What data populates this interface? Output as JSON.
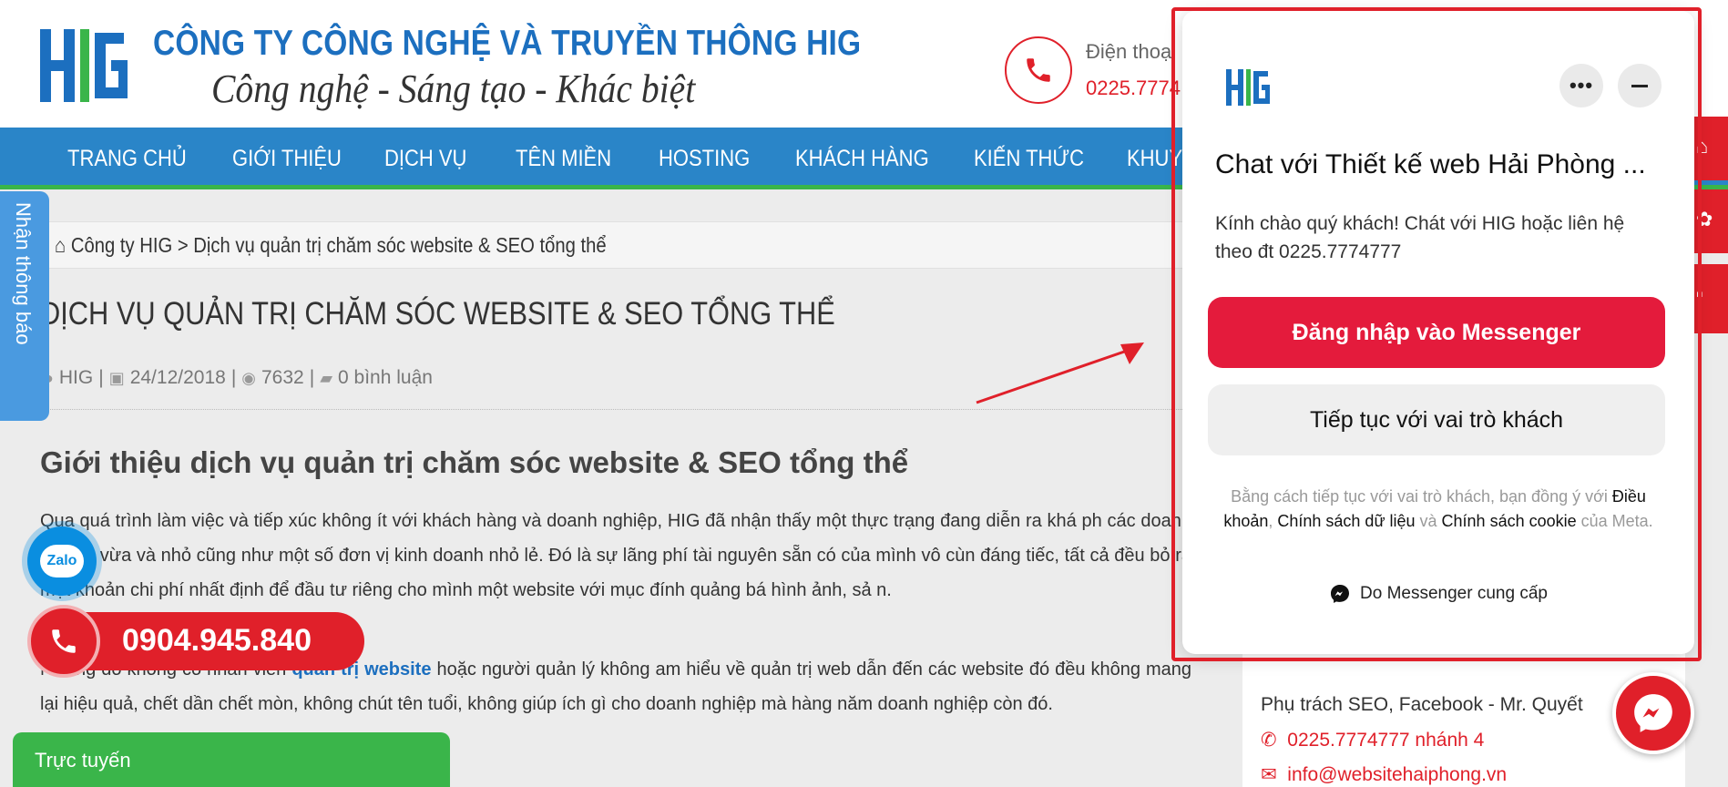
{
  "header": {
    "company_name": "CÔNG TY CÔNG NGHỆ VÀ TRUYỀN THÔNG HIG",
    "slogan": "Công nghệ - Sáng tạo - Khác biệt",
    "phone_label": "Điện thoại",
    "phone_number": "0225.7774",
    "logo_icon": "hig-logo-icon",
    "colors": {
      "brand_blue": "#1c6fbf",
      "accent_red": "#e0202a",
      "nav_green": "#3ab54a"
    }
  },
  "nav": {
    "items": [
      {
        "label": "TRANG CHỦ"
      },
      {
        "label": "GIỚI THIỆU"
      },
      {
        "label": "DỊCH VỤ"
      },
      {
        "label": "TÊN MIỀN"
      },
      {
        "label": "HOSTING"
      },
      {
        "label": "KHÁCH HÀNG"
      },
      {
        "label": "KIẾN THỨC"
      },
      {
        "label": "KHUY"
      }
    ]
  },
  "breadcrumb": {
    "text": "Công ty HIG > Dịch vụ quản trị chăm sóc website & SEO tổng thể",
    "icon": "home-icon"
  },
  "article": {
    "title": "DỊCH VỤ QUẢN TRỊ CHĂM SÓC WEBSITE & SEO TỔNG THỂ",
    "meta": {
      "author": "HIG",
      "date": "24/12/2018",
      "views": "7632",
      "comments": "0 bình luận"
    },
    "section_heading": "Giới thiệu dịch vụ quản trị chăm sóc website & SEO tổng thể",
    "para1": "Qua quá trình làm việc và tiếp xúc không ít với khách hàng và doanh nghiệp, HIG đã nhận thấy một thực trạng đang diễn ra khá ph các doanh nghiệp vừa và nhỏ cũng như một số đơn vị kinh doanh nhỏ lẻ. Đó là sự lãng phí tài nguyên sẵn có của mình vô cùn đáng tiếc, tất cả đều bỏ ra một khoản chi phí nhất định để đầu tư riêng cho mình một website với mục đính quảng bá hình ảnh, sả n.",
    "para2_before": "Nhưng do không có nhân viên ",
    "para2_link": "quản trị website",
    "para2_after": " hoặc người quản lý không am hiểu về quản trị web dẫn đến các website đó đều không mang lại hiệu quả, chết dần chết mòn, không chút tên tuổi, không giúp ích gì cho doanh nghiệp mà hàng năm doanh nghiệp còn đó."
  },
  "sidebar": {
    "line1": "Phụ trách SEO, Facebook - Mr. Quyết",
    "line2": "0225.7774777 nhánh 4",
    "line3": "info@websitehaiphong.vn"
  },
  "widgets": {
    "notify_label": "Nhận thông báo",
    "zalo_label": "Zalo",
    "hotline": "0904.945.840",
    "online_label": "Trực tuyến"
  },
  "messenger_popup": {
    "title": "Chat với Thiết kế web Hải Phòng ...",
    "greeting": "Kính chào quý khách! Chát với HIG hoặc liên hệ theo đt 0225.7774777",
    "login_button": "Đăng nhập vào Messenger",
    "guest_button": "Tiếp tục với vai trò khách",
    "terms_prefix": "Bằng cách tiếp tục với vai trò khách, bạn đồng ý với ",
    "terms_link1": "Điều khoản",
    "terms_sep1": ", ",
    "terms_link2": "Chính sách dữ liệu",
    "terms_sep2": " và ",
    "terms_link3": "Chính sách cookie",
    "terms_suffix": " của Meta.",
    "provided_by": "Do Messenger cung cấp",
    "colors": {
      "login_red": "#e41b3c",
      "outline_red": "#e0202a"
    }
  }
}
